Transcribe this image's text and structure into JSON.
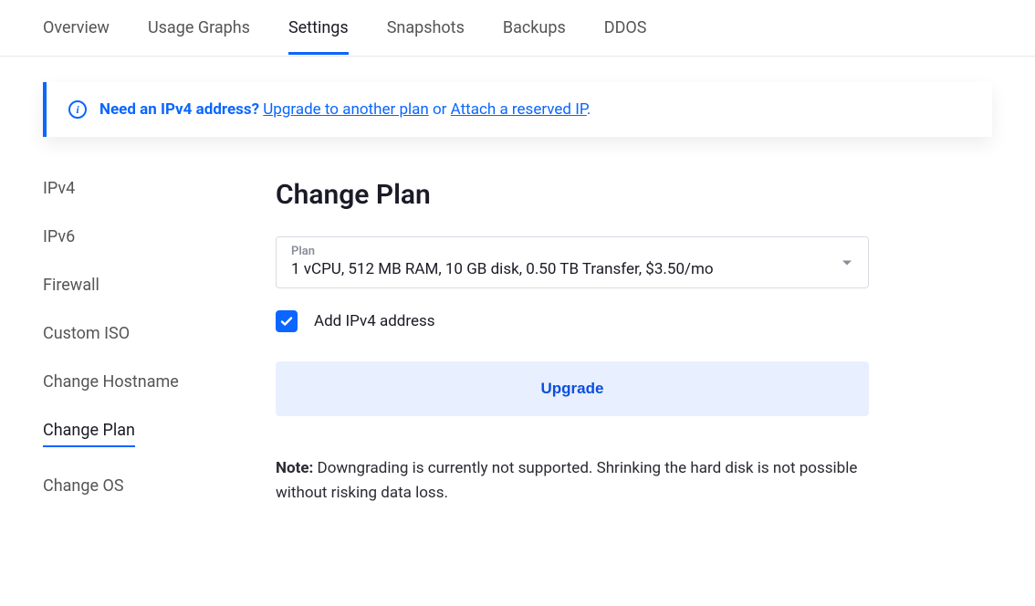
{
  "tabs": [
    {
      "label": "Overview"
    },
    {
      "label": "Usage Graphs"
    },
    {
      "label": "Settings"
    },
    {
      "label": "Snapshots"
    },
    {
      "label": "Backups"
    },
    {
      "label": "DDOS"
    }
  ],
  "active_tab_index": 2,
  "alert": {
    "question": "Need an IPv4 address?",
    "link1": "Upgrade to another plan",
    "middle": " or ",
    "link2": "Attach a reserved IP",
    "end": "."
  },
  "sidebar": {
    "items": [
      {
        "label": "IPv4"
      },
      {
        "label": "IPv6"
      },
      {
        "label": "Firewall"
      },
      {
        "label": "Custom ISO"
      },
      {
        "label": "Change Hostname"
      },
      {
        "label": "Change Plan"
      },
      {
        "label": "Change OS"
      }
    ],
    "active_index": 5
  },
  "content": {
    "heading": "Change Plan",
    "plan_select": {
      "label": "Plan",
      "value": "1 vCPU, 512 MB RAM, 10 GB disk, 0.50 TB Transfer, $3.50/mo"
    },
    "checkbox": {
      "label": "Add IPv4 address",
      "checked": true
    },
    "upgrade_button": "Upgrade",
    "note_bold": "Note:",
    "note_text": " Downgrading is currently not supported. Shrinking the hard disk is not possible without risking data loss."
  }
}
